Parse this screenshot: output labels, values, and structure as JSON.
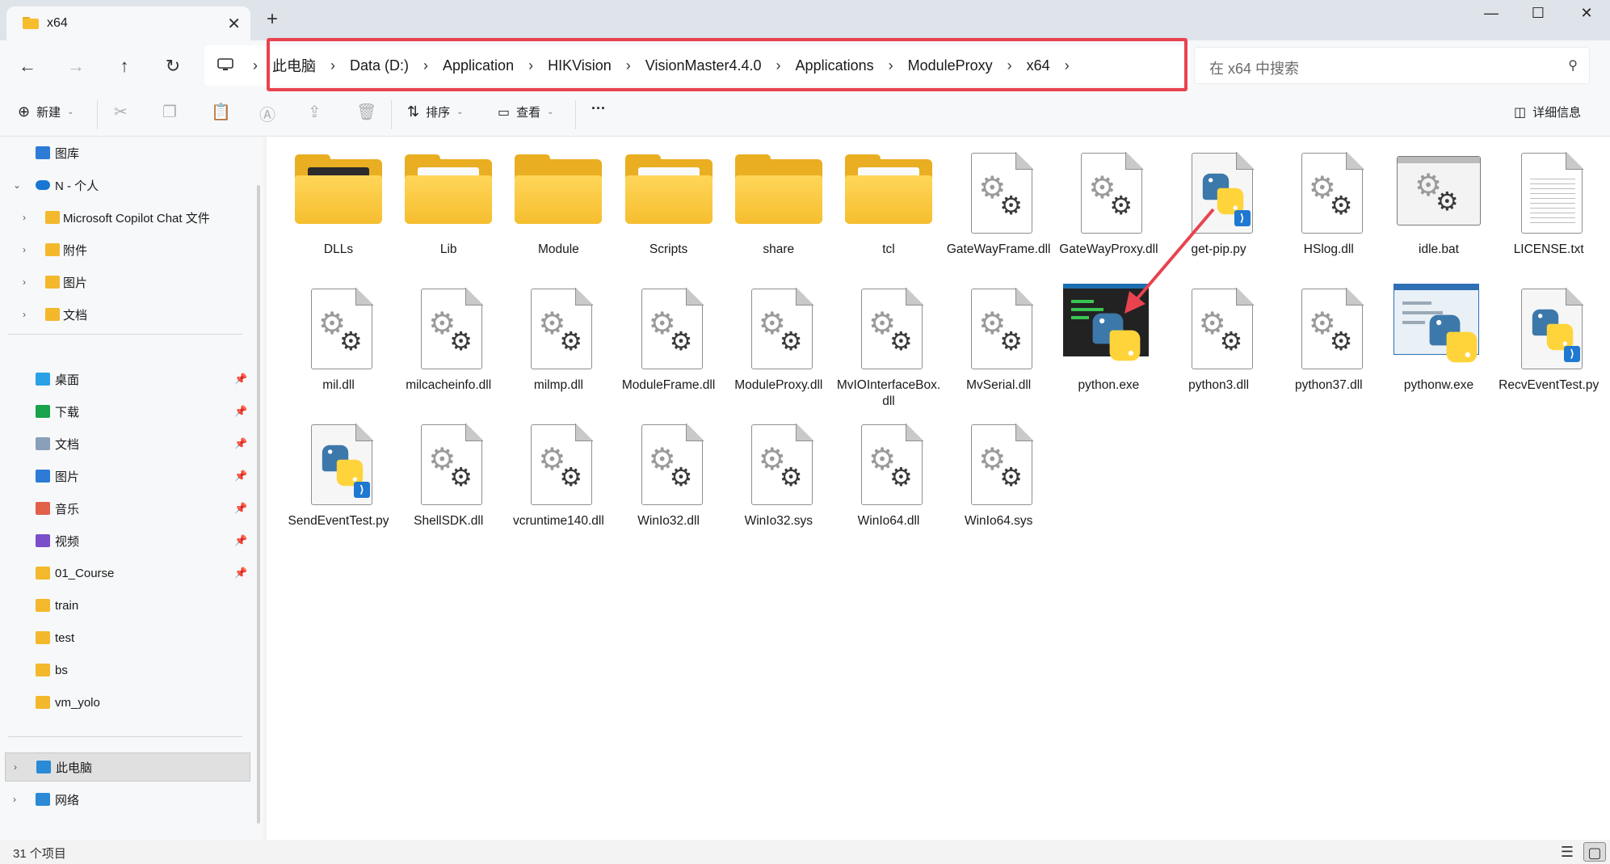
{
  "window": {
    "tab_title": "x64",
    "tab_close": "✕",
    "new_tab": "+",
    "minimize": "—",
    "maximize": "☐",
    "close": "✕"
  },
  "address_bar": {
    "breadcrumbs": [
      "此电脑",
      "Data (D:)",
      "Application",
      "HIKVision",
      "VisionMaster4.4.0",
      "Applications",
      "ModuleProxy",
      "x64"
    ],
    "separator": "›"
  },
  "search": {
    "placeholder": "在 x64 中搜索"
  },
  "toolbar": {
    "new_label": "新建",
    "sort_label": "排序",
    "view_label": "查看",
    "more_label": "···",
    "details_label": "详细信息"
  },
  "sidebar": {
    "items": [
      {
        "label": "图库",
        "icon": "gallery-icon"
      },
      {
        "label": "N - 个人",
        "icon": "onedrive-icon"
      },
      {
        "label": "Microsoft Copilot Chat 文件",
        "icon": "folder-icon"
      },
      {
        "label": "附件",
        "icon": "folder-icon"
      },
      {
        "label": "图片",
        "icon": "folder-icon"
      },
      {
        "label": "文档",
        "icon": "folder-icon"
      },
      {
        "label": "桌面",
        "icon": "desktop-icon"
      },
      {
        "label": "下载",
        "icon": "download-icon"
      },
      {
        "label": "文档",
        "icon": "documents-icon"
      },
      {
        "label": "图片",
        "icon": "pictures-icon"
      },
      {
        "label": "音乐",
        "icon": "music-icon"
      },
      {
        "label": "视频",
        "icon": "videos-icon"
      },
      {
        "label": "01_Course",
        "icon": "folder-icon"
      },
      {
        "label": "train",
        "icon": "folder-icon"
      },
      {
        "label": "test",
        "icon": "folder-icon"
      },
      {
        "label": "bs",
        "icon": "folder-icon"
      },
      {
        "label": "vm_yolo",
        "icon": "folder-icon"
      },
      {
        "label": "此电脑",
        "icon": "this-pc-icon"
      },
      {
        "label": "网络",
        "icon": "network-icon"
      }
    ]
  },
  "files": [
    {
      "name": "DLLs",
      "type": "folder"
    },
    {
      "name": "Lib",
      "type": "folder"
    },
    {
      "name": "Module",
      "type": "folder"
    },
    {
      "name": "Scripts",
      "type": "folder"
    },
    {
      "name": "share",
      "type": "folder"
    },
    {
      "name": "tcl",
      "type": "folder"
    },
    {
      "name": "GateWayFrame.dll",
      "type": "dll"
    },
    {
      "name": "GateWayProxy.dll",
      "type": "dll"
    },
    {
      "name": "get-pip.py",
      "type": "py"
    },
    {
      "name": "HSlog.dll",
      "type": "dll"
    },
    {
      "name": "idle.bat",
      "type": "bat"
    },
    {
      "name": "LICENSE.txt",
      "type": "txt"
    },
    {
      "name": "mil.dll",
      "type": "dll"
    },
    {
      "name": "milcacheinfo.dll",
      "type": "dll"
    },
    {
      "name": "milmp.dll",
      "type": "dll"
    },
    {
      "name": "ModuleFrame.dll",
      "type": "dll"
    },
    {
      "name": "ModuleProxy.dll",
      "type": "dll"
    },
    {
      "name": "MvIOInterfaceBox.dll",
      "type": "dll"
    },
    {
      "name": "MvSerial.dll",
      "type": "dll"
    },
    {
      "name": "python.exe",
      "type": "exe"
    },
    {
      "name": "python3.dll",
      "type": "dll"
    },
    {
      "name": "python37.dll",
      "type": "dll"
    },
    {
      "name": "pythonw.exe",
      "type": "exew"
    },
    {
      "name": "RecvEventTest.py",
      "type": "py"
    },
    {
      "name": "SendEventTest.py",
      "type": "py"
    },
    {
      "name": "ShellSDK.dll",
      "type": "dll"
    },
    {
      "name": "vcruntime140.dll",
      "type": "dll"
    },
    {
      "name": "WinIo32.dll",
      "type": "dll"
    },
    {
      "name": "WinIo32.sys",
      "type": "dll"
    },
    {
      "name": "WinIo64.dll",
      "type": "dll"
    },
    {
      "name": "WinIo64.sys",
      "type": "dll"
    }
  ],
  "status": {
    "item_count": "31 个项目"
  },
  "colors": {
    "highlight_box": "#e8434f",
    "annotation_arrow": "#e8434f",
    "folder_yellow": "#f6be2f"
  }
}
